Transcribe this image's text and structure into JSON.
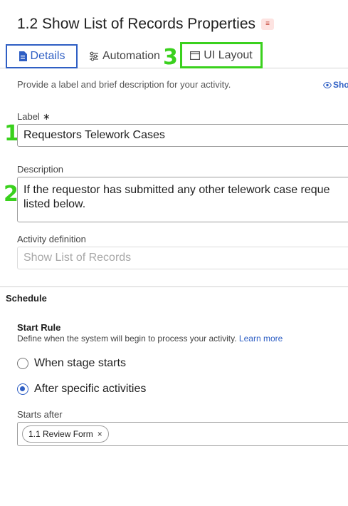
{
  "page": {
    "title": "1.2 Show List of Records Properties"
  },
  "tabs": [
    {
      "label": "Details"
    },
    {
      "label": "Automation"
    },
    {
      "label": "UI Layout"
    }
  ],
  "markers": [
    "1",
    "2",
    "3"
  ],
  "intro": "Provide a label and brief description for your activity.",
  "show_link": "Sho",
  "label_field": {
    "label": "Label",
    "required_mark": "∗",
    "value": "Requestors Telework Cases"
  },
  "description_field": {
    "label": "Description",
    "value": "If the requestor has submitted any other telework case reque listed below."
  },
  "activity_definition": {
    "label": "Activity definition",
    "placeholder": "Show List of Records"
  },
  "schedule": {
    "section_title": "Schedule",
    "start_rule_title": "Start Rule",
    "start_rule_desc": "Define when the system will begin to process your activity.",
    "learn_more": "Learn more",
    "options": [
      {
        "label": "When stage starts",
        "checked": false
      },
      {
        "label": "After specific activities",
        "checked": true
      }
    ],
    "starts_after_label": "Starts after",
    "chips": [
      {
        "label": "1.1 Review Form",
        "remove": "×"
      }
    ]
  },
  "colors": {
    "accent": "#2f5fc4",
    "highlight_green": "#3ad11d"
  }
}
